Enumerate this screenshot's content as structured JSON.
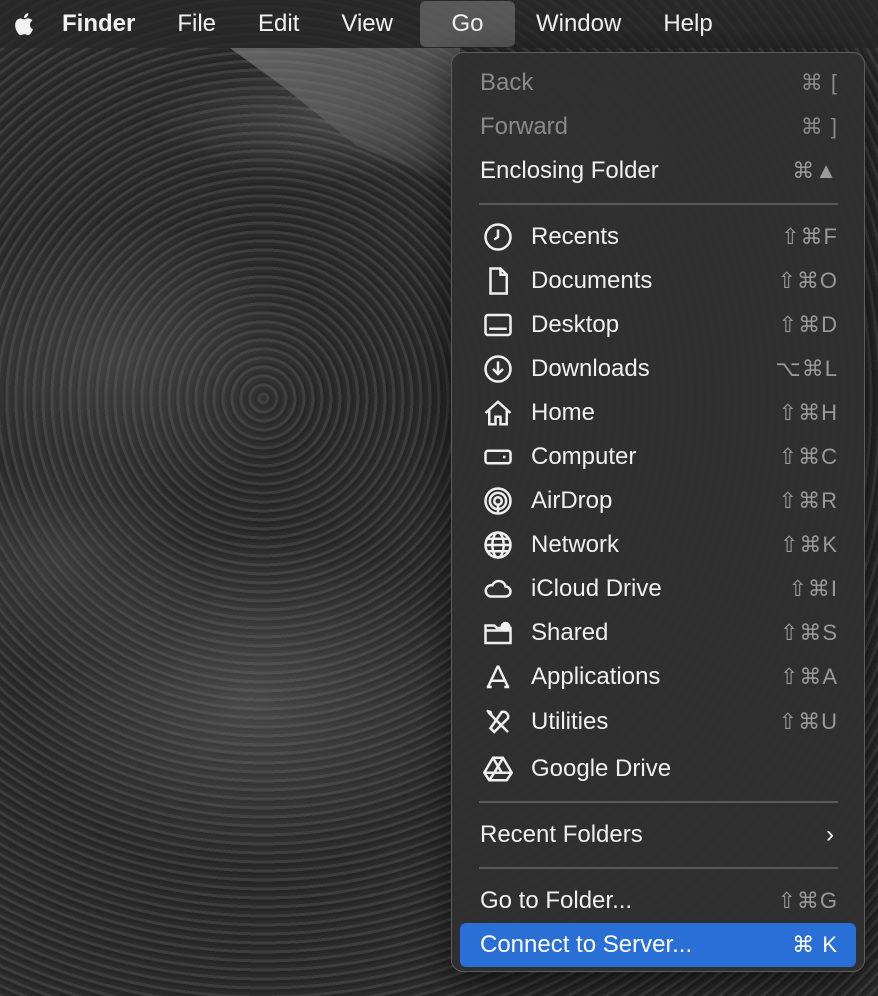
{
  "menubar": {
    "apple": "apple-logo",
    "app": "Finder",
    "items": [
      "File",
      "Edit",
      "View",
      "Go",
      "Window",
      "Help"
    ]
  },
  "menu": {
    "top": [
      {
        "label": "Back",
        "shortcut": "⌘ [",
        "enabled": false
      },
      {
        "label": "Forward",
        "shortcut": "⌘ ]",
        "enabled": false
      },
      {
        "label": "Enclosing Folder",
        "shortcut": "⌘▲",
        "enabled": true
      }
    ],
    "places": [
      {
        "label": "Recents",
        "icon": "clock-icon",
        "shortcut": "⇧⌘F"
      },
      {
        "label": "Documents",
        "icon": "document-icon",
        "shortcut": "⇧⌘O"
      },
      {
        "label": "Desktop",
        "icon": "desktop-icon",
        "shortcut": "⇧⌘D"
      },
      {
        "label": "Downloads",
        "icon": "download-icon",
        "shortcut": "⌥⌘L"
      },
      {
        "label": "Home",
        "icon": "home-icon",
        "shortcut": "⇧⌘H"
      },
      {
        "label": "Computer",
        "icon": "computer-icon",
        "shortcut": "⇧⌘C"
      },
      {
        "label": "AirDrop",
        "icon": "airdrop-icon",
        "shortcut": "⇧⌘R"
      },
      {
        "label": "Network",
        "icon": "globe-icon",
        "shortcut": "⇧⌘K"
      },
      {
        "label": "iCloud Drive",
        "icon": "cloud-icon",
        "shortcut": "⇧⌘I"
      },
      {
        "label": "Shared",
        "icon": "shared-folder-icon",
        "shortcut": "⇧⌘S"
      },
      {
        "label": "Applications",
        "icon": "applications-icon",
        "shortcut": "⇧⌘A"
      },
      {
        "label": "Utilities",
        "icon": "utilities-icon",
        "shortcut": "⇧⌘U"
      },
      {
        "label": "Google Drive",
        "icon": "google-drive-icon",
        "shortcut": ""
      }
    ],
    "recent_folders": {
      "label": "Recent Folders",
      "icon": "chevron-right-icon",
      "glyph": "›"
    },
    "bottom": [
      {
        "label": "Go to Folder...",
        "shortcut": "⇧⌘G",
        "selected": false
      },
      {
        "label": "Connect to Server...",
        "shortcut": "⌘ K",
        "selected": true
      }
    ]
  },
  "colors": {
    "selection": "#2a6fd6",
    "menu_bg": "#303030"
  }
}
